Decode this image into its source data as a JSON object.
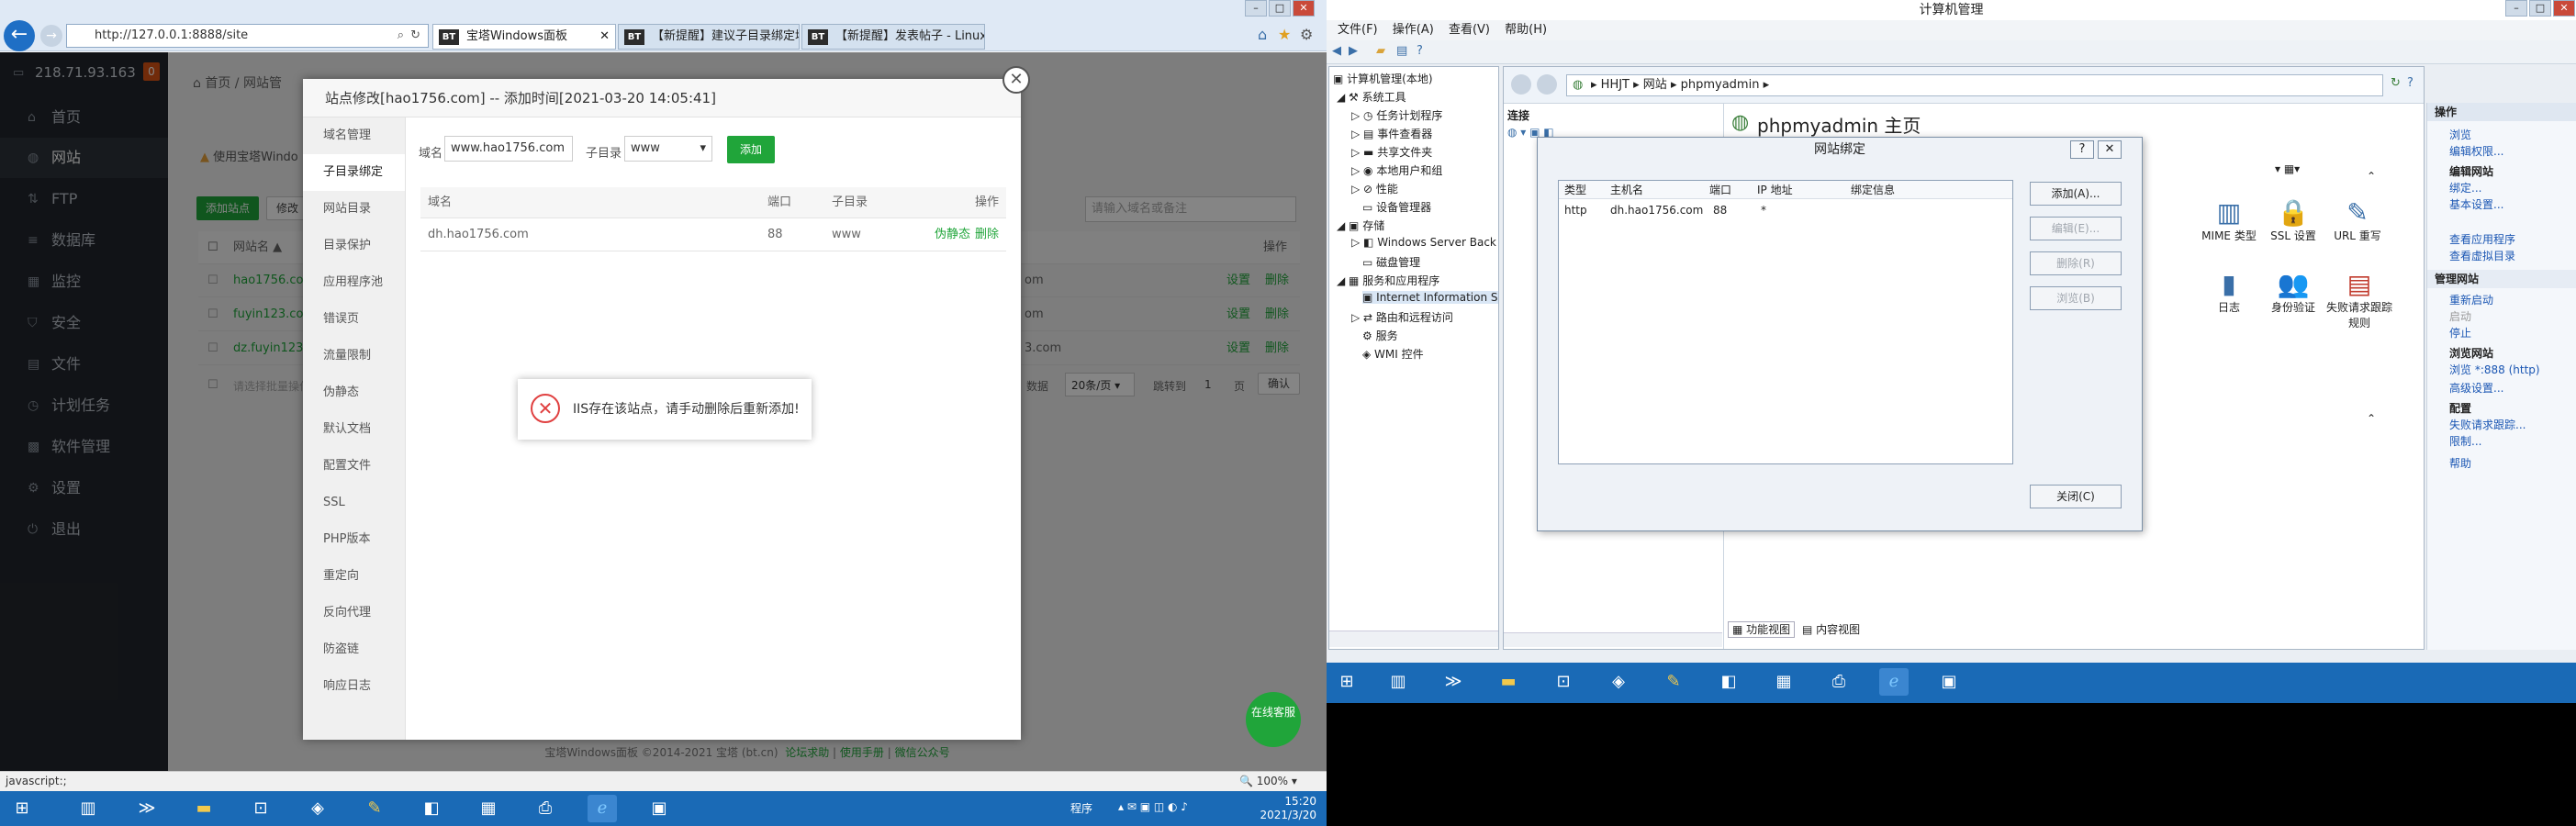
{
  "browser": {
    "address": "http://127.0.0.1:8888/site",
    "tabs": [
      {
        "favicon": "BT",
        "label": "宝塔Windows面板"
      },
      {
        "favicon": "BT",
        "label": "【新提醒】建议子目录绑定域..."
      },
      {
        "favicon": "BT",
        "label": "【新提醒】发表帖子 - Linux面..."
      }
    ],
    "status_text": "javascript:;",
    "zoom": "100%"
  },
  "panel": {
    "ip": "218.71.93.163",
    "badge": "0",
    "nav": [
      "首页",
      "网站",
      "FTP",
      "数据库",
      "监控",
      "安全",
      "文件",
      "计划任务",
      "软件管理",
      "设置",
      "退出"
    ],
    "active_nav": "网站",
    "breadcrumb": [
      "首页",
      "网站管"
    ],
    "warning": "使用宝塔Windo",
    "add_site": "添加站点",
    "modify": "修改",
    "search_placeholder": "请输入域名或备注",
    "col_sitename": "网站名 ▲",
    "col_ops": "操作",
    "sites": [
      {
        "name": "hao1756.com",
        "tail": "om",
        "ops": [
          "设置",
          "删除"
        ]
      },
      {
        "name": "fuyin123.co",
        "tail": "om",
        "ops": [
          "设置",
          "删除"
        ]
      },
      {
        "name": "dz.fuyin123.c",
        "tail": "3.com",
        "ops": [
          "设置",
          "删除"
        ]
      }
    ],
    "batch_placeholder": "请选择批量操作",
    "pager": {
      "total": "数据",
      "per_page": "20条/页",
      "jump": "跳转到",
      "page": "1",
      "unit": "页",
      "confirm": "确认"
    },
    "footer": "宝塔Windows面板 ©2014-2021 宝塔 (bt.cn)",
    "footer_links": [
      "论坛求助",
      "使用手册",
      "微信公众号"
    ],
    "chat": "在线客服"
  },
  "modal": {
    "title": "站点修改[hao1756.com] -- 添加时间[2021-03-20 14:05:41]",
    "nav": [
      "域名管理",
      "子目录绑定",
      "网站目录",
      "目录保护",
      "应用程序池",
      "错误页",
      "流量限制",
      "伪静态",
      "默认文档",
      "配置文件",
      "SSL",
      "PHP版本",
      "重定向",
      "反向代理",
      "防盗链",
      "响应日志"
    ],
    "active": "子目录绑定",
    "domain_label": "域名",
    "domain_value": "www.hao1756.com",
    "subdir_label": "子目录",
    "subdir_value": "www",
    "add_button": "添加",
    "table_headers": [
      "域名",
      "端口",
      "子目录",
      "操作"
    ],
    "rows": [
      {
        "domain": "dh.hao1756.com",
        "port": "88",
        "subdir": "www",
        "ops": [
          "伪静态",
          "删除"
        ]
      }
    ],
    "toast": "IIS存在该站点，请手动删除后重新添加!"
  },
  "taskbar_left": {
    "lang": "程序",
    "time": "15:20",
    "date": "2021/3/20"
  },
  "mmc": {
    "title": "计算机管理",
    "menu": [
      "文件(F)",
      "操作(A)",
      "查看(V)",
      "帮助(H)"
    ],
    "tree": [
      {
        "label": "计算机管理(本地)",
        "level": 0
      },
      {
        "label": "系统工具",
        "level": 1
      },
      {
        "label": "任务计划程序",
        "level": 2
      },
      {
        "label": "事件查看器",
        "level": 2
      },
      {
        "label": "共享文件夹",
        "level": 2
      },
      {
        "label": "本地用户和组",
        "level": 2
      },
      {
        "label": "性能",
        "level": 2
      },
      {
        "label": "设备管理器",
        "level": 2
      },
      {
        "label": "存储",
        "level": 1
      },
      {
        "label": "Windows Server Back",
        "level": 2
      },
      {
        "label": "磁盘管理",
        "level": 2
      },
      {
        "label": "服务和应用程序",
        "level": 1
      },
      {
        "label": "Internet Information S",
        "level": 2
      },
      {
        "label": "路由和远程访问",
        "level": 2
      },
      {
        "label": "服务",
        "level": 2
      },
      {
        "label": "WMI 控件",
        "level": 2
      }
    ],
    "iis_path": [
      "HHJT",
      "网站",
      "phpmyadmin"
    ],
    "connections": "连接",
    "home_title": "phpmyadmin 主页",
    "features": [
      {
        "name": "MIME 类型",
        "icon": "mime-icon"
      },
      {
        "name": "SSL 设置",
        "icon": "lock-icon"
      },
      {
        "name": "URL 重写",
        "icon": "rewrite-icon"
      },
      {
        "name": "日志",
        "icon": "log-icon"
      },
      {
        "name": "身份验证",
        "icon": "users-icon"
      },
      {
        "name": "失败请求跟踪规则",
        "icon": "failed-icon"
      }
    ],
    "view_tabs": [
      "功能视图",
      "内容视图"
    ],
    "actions_header": "操作",
    "actions": [
      {
        "type": "link",
        "text": "浏览"
      },
      {
        "type": "link",
        "text": "编辑权限..."
      },
      {
        "type": "section",
        "text": "编辑网站"
      },
      {
        "type": "link",
        "text": "绑定..."
      },
      {
        "type": "link",
        "text": "基本设置..."
      },
      {
        "type": "gap",
        "text": ""
      },
      {
        "type": "link",
        "text": "查看应用程序"
      },
      {
        "type": "link",
        "text": "查看虚拟目录"
      },
      {
        "type": "header",
        "text": "管理网站"
      },
      {
        "type": "link",
        "text": "重新启动"
      },
      {
        "type": "disabled",
        "text": "启动"
      },
      {
        "type": "link",
        "text": "停止"
      },
      {
        "type": "section",
        "text": "浏览网站"
      },
      {
        "type": "link",
        "text": "浏览 *:888 (http)"
      },
      {
        "type": "link",
        "text": "高级设置..."
      },
      {
        "type": "section",
        "text": "配置"
      },
      {
        "type": "link",
        "text": "失败请求跟踪..."
      },
      {
        "type": "link",
        "text": "限制..."
      },
      {
        "type": "link",
        "text": "帮助"
      }
    ]
  },
  "binding_dialog": {
    "title": "网站绑定",
    "help": "?",
    "close": "✕",
    "headers": [
      "类型",
      "主机名",
      "端口",
      "IP 地址",
      "绑定信息"
    ],
    "rows": [
      {
        "type": "http",
        "host": "dh.hao1756.com",
        "port": "88",
        "ip": "*",
        "info": ""
      }
    ],
    "buttons": [
      {
        "label": "添加(A)...",
        "enabled": true
      },
      {
        "label": "编辑(E)...",
        "enabled": false
      },
      {
        "label": "删除(R)",
        "enabled": false
      },
      {
        "label": "浏览(B)",
        "enabled": false
      }
    ],
    "close_button": "关闭(C)"
  },
  "colors": {
    "green": "#20a53a",
    "sidebar": "#22262c",
    "taskbar": "#1a6ab6",
    "link": "#1a56b3",
    "error": "#e04040"
  }
}
